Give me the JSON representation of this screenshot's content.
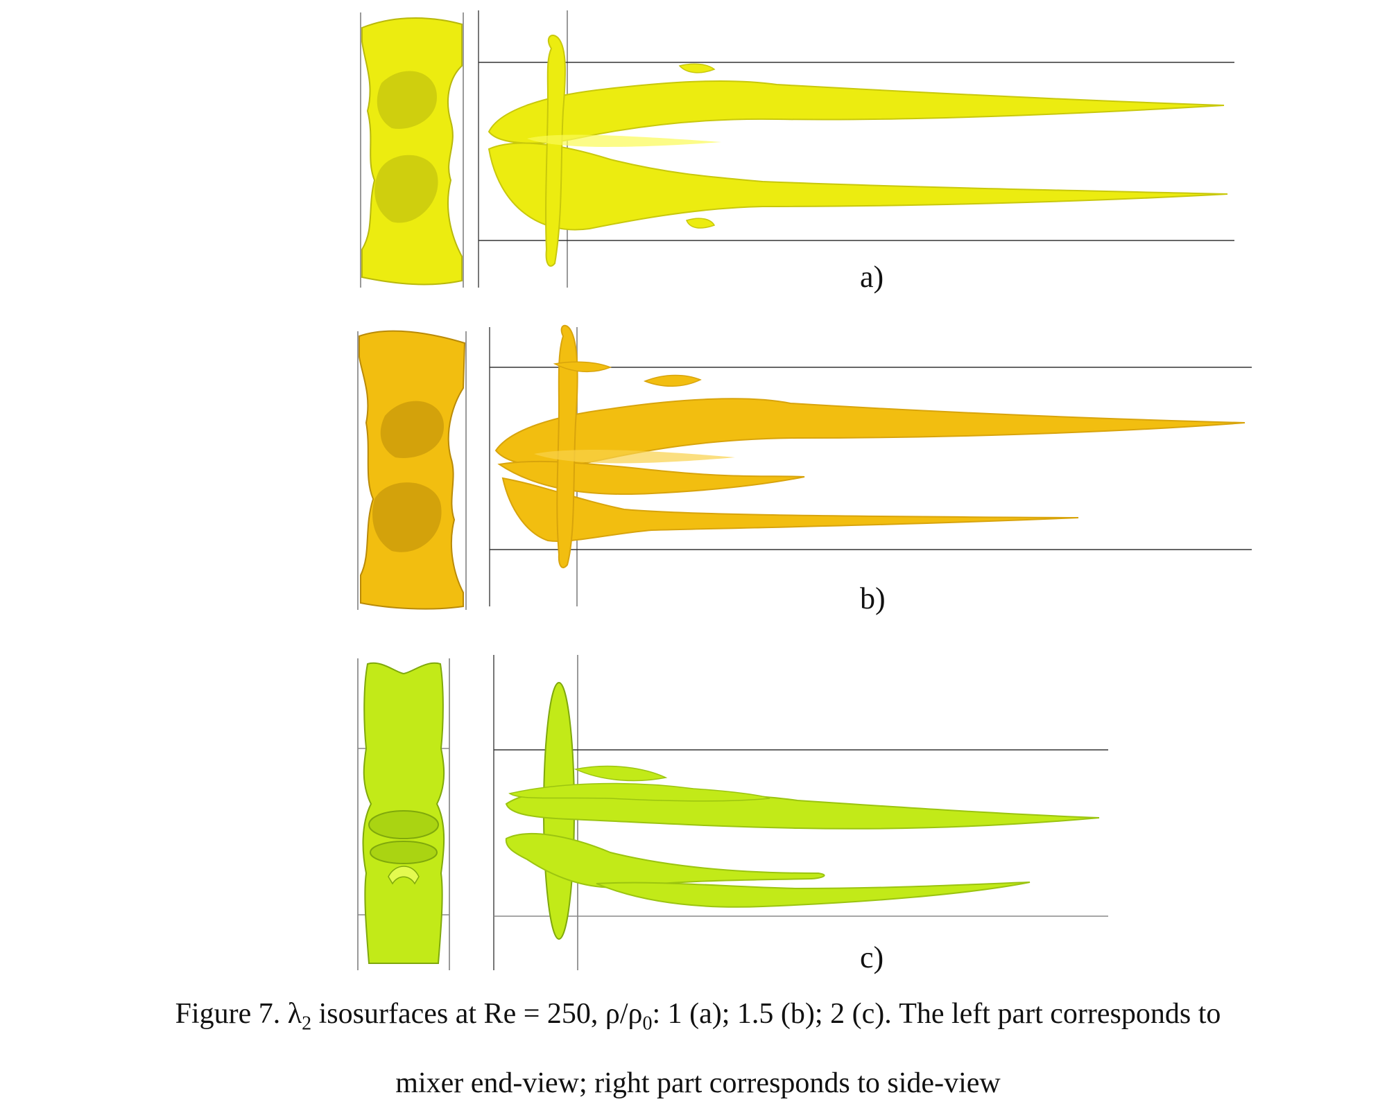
{
  "figure": {
    "panels": [
      {
        "id": "a",
        "label": "a)",
        "color": "#ecec10",
        "shade": "#b8b80c",
        "highlight": "#fbfb55"
      },
      {
        "id": "b",
        "label": "b)",
        "color": "#f2be10",
        "shade": "#b98a08",
        "highlight": "#fad24a"
      },
      {
        "id": "c",
        "label": "c)",
        "color": "#c2ea18",
        "shade": "#7fa80c",
        "highlight": "#e4fa50"
      }
    ],
    "caption": {
      "line1_prefix": "Figure 7. λ",
      "line1_sub2": "2",
      "line1_mid": " isosurfaces at Re = 250, ρ/ρ",
      "line1_sub0": "0",
      "line1_suffix": ": 1 (a); 1.5 (b); 2 (c). The left part corresponds to",
      "line2": "mixer end-view; right part corresponds to side-view"
    }
  }
}
